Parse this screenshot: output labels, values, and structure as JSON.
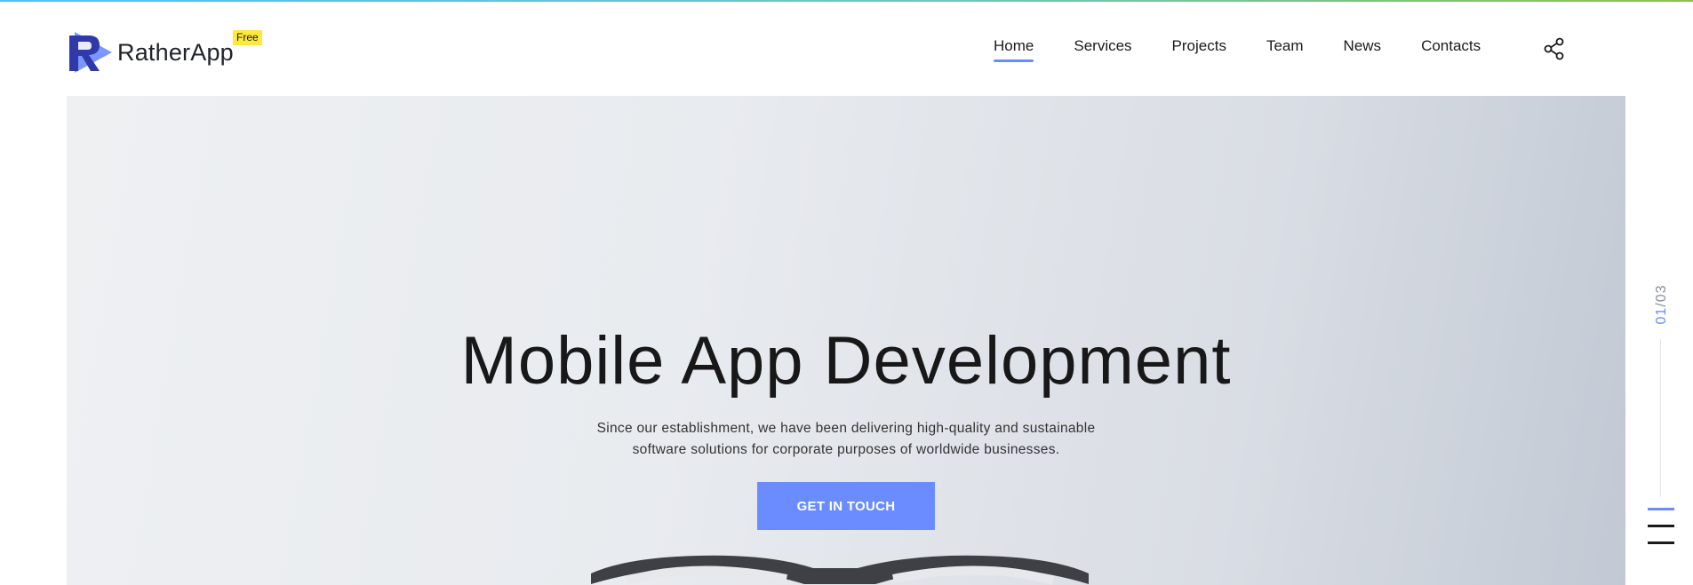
{
  "brand": {
    "name": "RatherApp",
    "badge": "Free",
    "logo_icon": "logo-r-play-icon",
    "accent_color": "#6a8cff",
    "badge_color": "#ffe93a"
  },
  "nav": {
    "items": [
      {
        "label": "Home",
        "active": true
      },
      {
        "label": "Services",
        "active": false
      },
      {
        "label": "Projects",
        "active": false
      },
      {
        "label": "Team",
        "active": false
      },
      {
        "label": "News",
        "active": false
      },
      {
        "label": "Contacts",
        "active": false
      }
    ],
    "share_icon": "share-icon"
  },
  "hero": {
    "title": "Mobile App Development",
    "text_line1": "Since our establishment, we have been delivering high-quality and sustainable",
    "text_line2": "software solutions for corporate purposes of worldwide businesses.",
    "cta_label": "GET IN TOUCH"
  },
  "slider": {
    "current": "01",
    "separator": "/",
    "total": "03"
  },
  "menu_toggle_icon": "hamburger-menu-icon"
}
